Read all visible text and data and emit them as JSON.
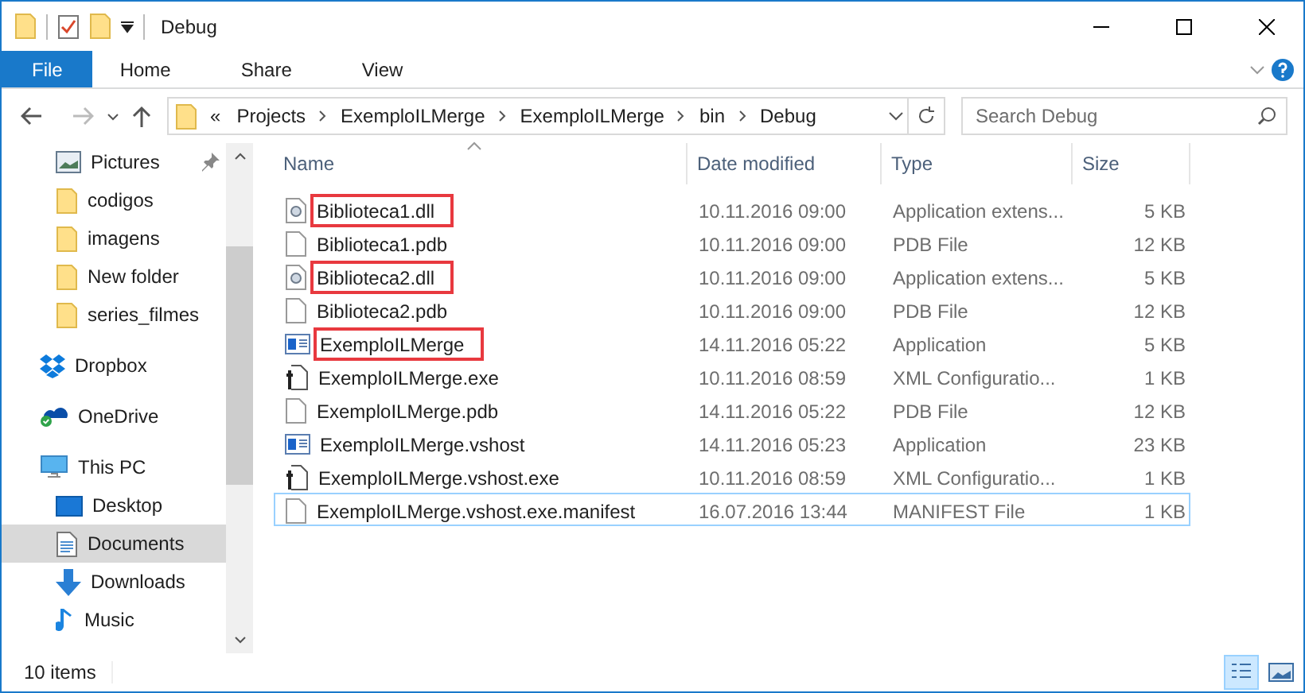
{
  "window": {
    "title": "Debug"
  },
  "ribbon_tabs": [
    {
      "label": "File",
      "kind": "file",
      "selected": false
    },
    {
      "label": "Home",
      "kind": "tab",
      "selected": false
    },
    {
      "label": "Share",
      "kind": "tab",
      "selected": false
    },
    {
      "label": "View",
      "kind": "tab",
      "selected": false
    }
  ],
  "address": {
    "overflow": "«",
    "path": [
      "Projects",
      "ExemploILMerge",
      "ExemploILMerge",
      "bin",
      "Debug"
    ]
  },
  "search": {
    "placeholder": "Search Debug"
  },
  "sidebar": {
    "quick_access": [
      {
        "label": "Pictures",
        "kind": "pictures",
        "pinned": true,
        "selected": false
      },
      {
        "label": "codigos",
        "kind": "folder",
        "pinned": false,
        "selected": false
      },
      {
        "label": "imagens",
        "kind": "folder",
        "pinned": false,
        "selected": false
      },
      {
        "label": "New folder",
        "kind": "folder",
        "pinned": false,
        "selected": false
      },
      {
        "label": "series_filmes",
        "kind": "folder",
        "pinned": false,
        "selected": false
      }
    ],
    "items": [
      {
        "label": "Dropbox",
        "kind": "dropbox",
        "selected": false
      },
      {
        "label": "OneDrive",
        "kind": "onedrive",
        "selected": false
      },
      {
        "label": "This PC",
        "kind": "pc",
        "selected": false,
        "children": [
          {
            "label": "Desktop",
            "kind": "desktop",
            "selected": false
          },
          {
            "label": "Documents",
            "kind": "documents",
            "selected": true
          },
          {
            "label": "Downloads",
            "kind": "downloads",
            "selected": false
          },
          {
            "label": "Music",
            "kind": "music",
            "selected": false
          }
        ]
      }
    ]
  },
  "table": {
    "columns": [
      "Name",
      "Date modified",
      "Type",
      "Size"
    ],
    "rows": [
      {
        "kind": "dll",
        "name": "Biblioteca1.dll",
        "date": "10.11.2016 09:00",
        "type": "Application extens...",
        "size": "5 KB",
        "highlighted": true,
        "focused": false
      },
      {
        "kind": "file",
        "name": "Biblioteca1.pdb",
        "date": "10.11.2016 09:00",
        "type": "PDB File",
        "size": "12 KB",
        "highlighted": false,
        "focused": false
      },
      {
        "kind": "dll",
        "name": "Biblioteca2.dll",
        "date": "10.11.2016 09:00",
        "type": "Application extens...",
        "size": "5 KB",
        "highlighted": true,
        "focused": false
      },
      {
        "kind": "file",
        "name": "Biblioteca2.pdb",
        "date": "10.11.2016 09:00",
        "type": "PDB File",
        "size": "12 KB",
        "highlighted": false,
        "focused": false
      },
      {
        "kind": "app",
        "name": "ExemploILMerge",
        "date": "14.11.2016 05:22",
        "type": "Application",
        "size": "5 KB",
        "highlighted": true,
        "focused": false
      },
      {
        "kind": "config",
        "name": "ExemploILMerge.exe",
        "date": "10.11.2016 08:59",
        "type": "XML Configuratio...",
        "size": "1 KB",
        "highlighted": false,
        "focused": false
      },
      {
        "kind": "file",
        "name": "ExemploILMerge.pdb",
        "date": "14.11.2016 05:22",
        "type": "PDB File",
        "size": "12 KB",
        "highlighted": false,
        "focused": false
      },
      {
        "kind": "app",
        "name": "ExemploILMerge.vshost",
        "date": "14.11.2016 05:23",
        "type": "Application",
        "size": "23 KB",
        "highlighted": false,
        "focused": false
      },
      {
        "kind": "config",
        "name": "ExemploILMerge.vshost.exe",
        "date": "10.11.2016 08:59",
        "type": "XML Configuratio...",
        "size": "1 KB",
        "highlighted": false,
        "focused": false
      },
      {
        "kind": "file",
        "name": "ExemploILMerge.vshost.exe.manifest",
        "date": "16.07.2016 13:44",
        "type": "MANIFEST File",
        "size": "1 KB",
        "highlighted": false,
        "focused": true
      }
    ]
  },
  "status_bar": {
    "count": "10 items",
    "view_buttons": [
      {
        "kind": "details",
        "selected": true
      },
      {
        "kind": "tiles",
        "selected": false
      }
    ]
  }
}
